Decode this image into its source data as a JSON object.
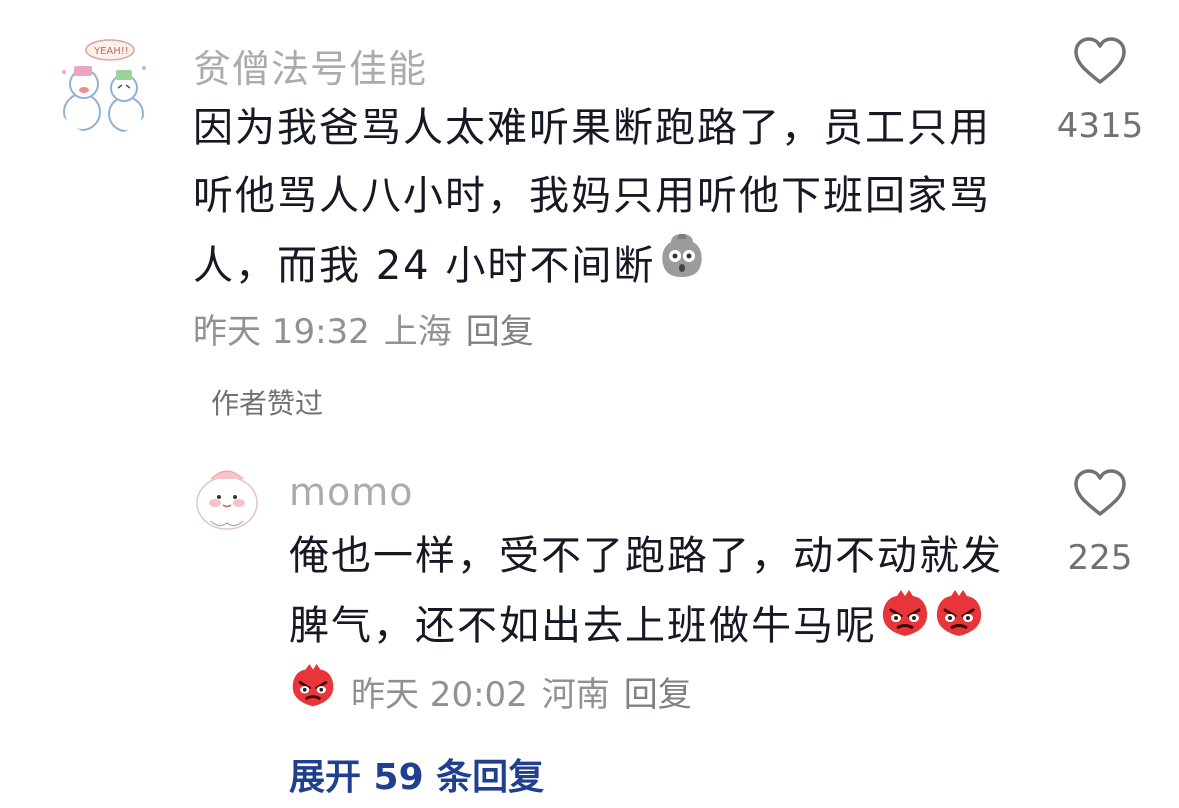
{
  "comment": {
    "username": "贫僧法号佳能",
    "text_line1": "因为我爸骂人太难听果断跑路了，员工只用",
    "text_line2": "听他骂人八小时，我妈只用听他下班回家骂",
    "text_line3": "人，而我 24 小时不间断",
    "time": "昨天 19:32",
    "location": "上海",
    "reply_label": "回复",
    "like_count": "4315",
    "author_badge": "作者赞过"
  },
  "reply": {
    "username": "momo",
    "text_line1": "俺也一样，受不了跑路了，动不动就发",
    "text_line2": "脾气，还不如出去上班做牛马呢",
    "time": "昨天 20:02",
    "location": "河南",
    "reply_label": "回复",
    "like_count": "225"
  },
  "expand_label": "展开 59 条回复",
  "icons": {
    "heart": "heart-outline-icon",
    "shock_emoji": "shocked-face-emoji",
    "angry_emoji": "angry-red-face-emoji"
  },
  "colors": {
    "username": "#a9abb0",
    "meta": "#8f9196",
    "expand": "#1f3f8f",
    "text": "#161823",
    "angry_red": "#e8353a"
  }
}
